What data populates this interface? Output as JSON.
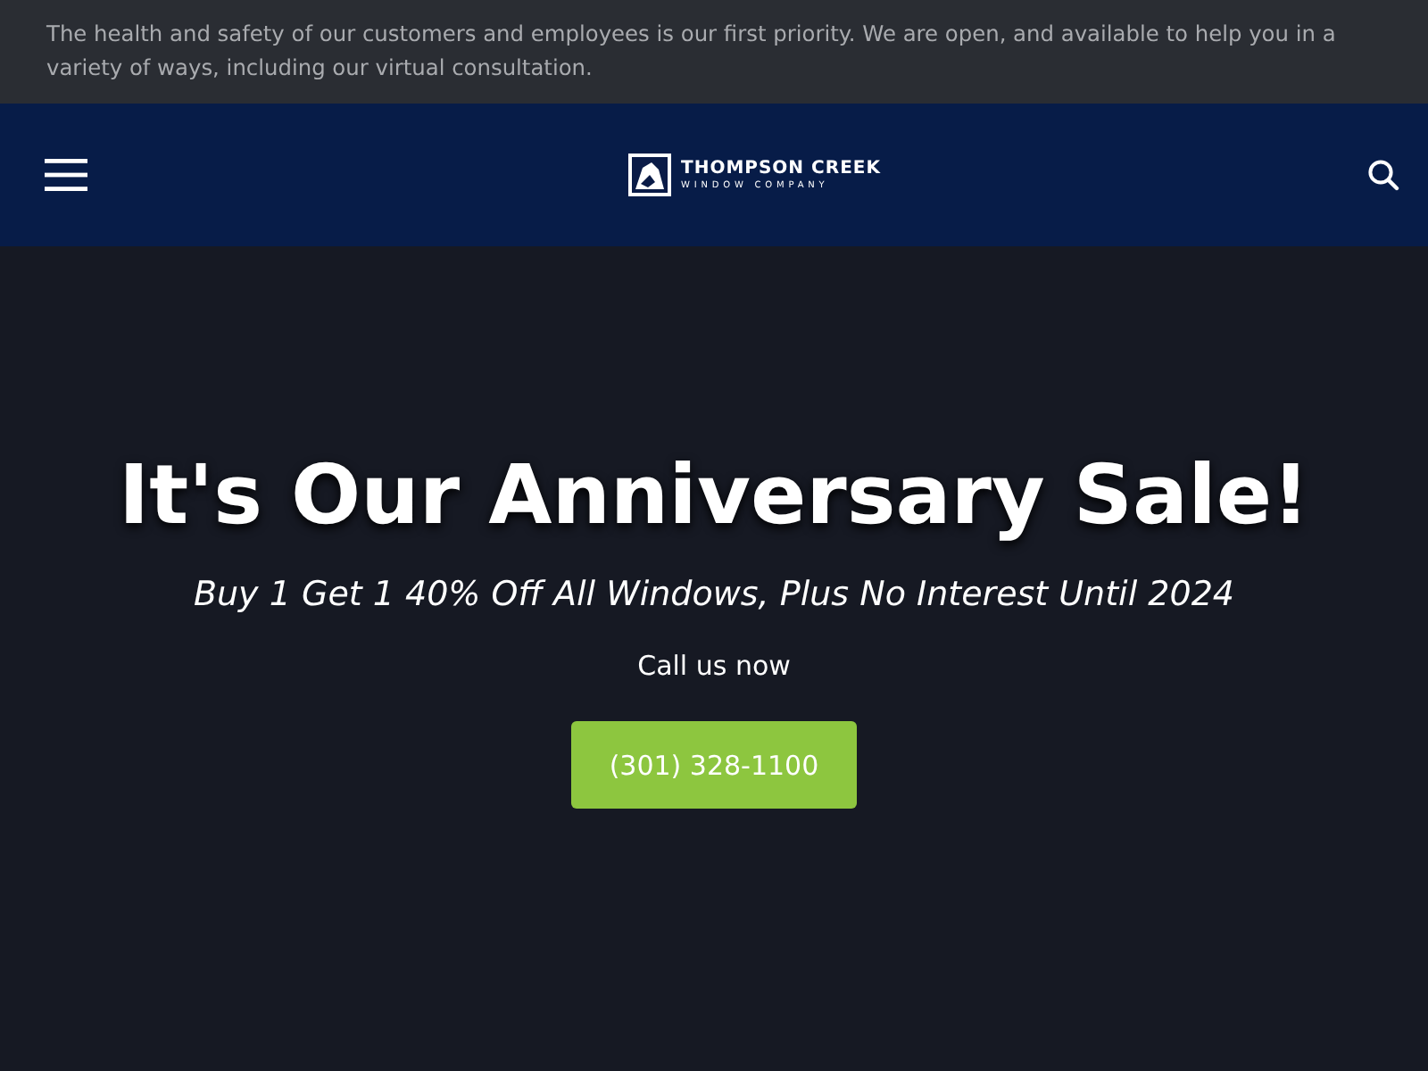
{
  "notice": "The health and safety of our customers and employees is our first priority. We are open, and available to help you in a variety of ways, including our virtual consultation.",
  "header": {
    "logo_title": "THOMPSON CREEK",
    "logo_subtitle": "WINDOW COMPANY"
  },
  "hero": {
    "title": "It's Our Anniversary Sale!",
    "subtitle": "Buy 1 Get 1 40% Off All Windows, Plus No Interest Until 2024",
    "call_label": "Call us now",
    "phone_button": "(301) 328-1100"
  }
}
